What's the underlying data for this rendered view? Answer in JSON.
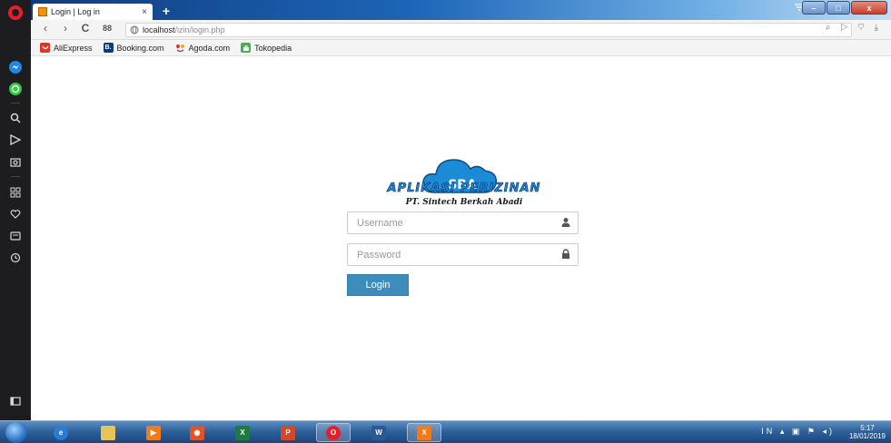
{
  "browser": {
    "tab": {
      "title": "Login | Log in",
      "close": "×"
    },
    "new_tab": "+",
    "window_controls": {
      "minimize": "–",
      "maximize": "□",
      "close": "x"
    },
    "nav": {
      "back": "‹",
      "forward": "›",
      "reload": "C",
      "speed_dial": "88"
    },
    "address": {
      "host": "localhost",
      "path": "/izin/login.php"
    },
    "bookmarks": [
      {
        "label": "AliExpress",
        "icon": "aliexpress-icon",
        "color": "#e43225"
      },
      {
        "label": "Booking.com",
        "icon": "booking-icon",
        "color": "#0c3b7c",
        "glyph": "B."
      },
      {
        "label": "Agoda.com",
        "icon": "agoda-icon",
        "color": "#f5a623"
      },
      {
        "label": "Tokopedia",
        "icon": "tokopedia-icon",
        "color": "#42b549"
      }
    ]
  },
  "page": {
    "logo": {
      "monogram": "SBA",
      "title": "APLIKASI PERIZINAN",
      "subtitle": "PT. Sintech Berkah Abadi"
    },
    "form": {
      "username_placeholder": "Username",
      "password_placeholder": "Password",
      "login_label": "Login"
    },
    "colors": {
      "primary": "#3c8dbc",
      "logo_blue": "#1c8bd6"
    }
  },
  "taskbar": {
    "tray_lang": "IN",
    "clock_time": "5:17",
    "clock_date": "18/01/2019",
    "apps": [
      {
        "name": "ie-icon",
        "glyph": "e",
        "color": "#2b7bd6"
      },
      {
        "name": "explorer-icon",
        "glyph": "",
        "color": "#e8c35a"
      },
      {
        "name": "media-player-icon",
        "glyph": "▶",
        "color": "#f07d1a"
      },
      {
        "name": "app-icon",
        "glyph": "◉",
        "color": "#e2532a"
      },
      {
        "name": "excel-icon",
        "glyph": "X",
        "color": "#1f7a3d"
      },
      {
        "name": "powerpoint-icon",
        "glyph": "P",
        "color": "#d04a2a"
      },
      {
        "name": "opera-icon",
        "glyph": "O",
        "color": "#e81d2b"
      },
      {
        "name": "word-icon",
        "glyph": "W",
        "color": "#2b5797"
      },
      {
        "name": "xampp-icon",
        "glyph": "X",
        "color": "#f27a1a"
      }
    ]
  }
}
